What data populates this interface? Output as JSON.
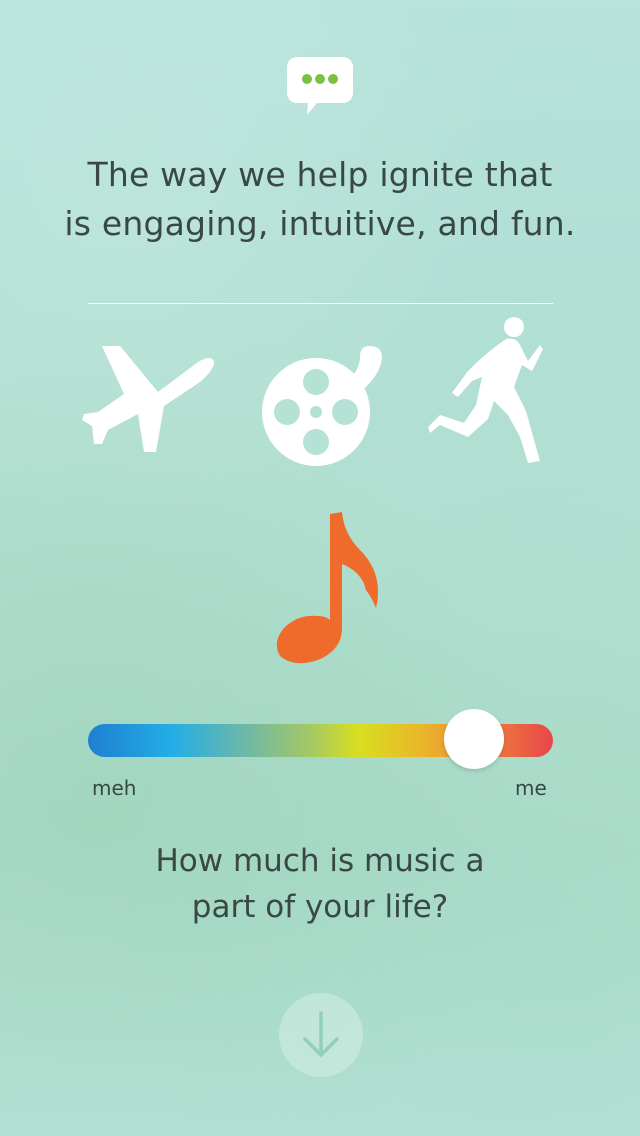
{
  "header": {
    "icon": "chat-bubble-icon",
    "headline_line1": "The way we help ignite that",
    "headline_line2": "is engaging, intuitive, and fun."
  },
  "categories": [
    {
      "icon": "airplane-icon"
    },
    {
      "icon": "film-reel-icon"
    },
    {
      "icon": "runner-icon"
    }
  ],
  "selected_category": {
    "icon": "music-note-icon",
    "color": "#ef6b2c"
  },
  "slider": {
    "value_fraction": 0.83,
    "min_label": "meh",
    "max_label": "me"
  },
  "question": {
    "line1": "How much is music a",
    "line2": "part of your life?"
  },
  "next_button": {
    "icon": "arrow-down-icon"
  },
  "colors": {
    "accent_green": "#7bc142",
    "note_orange": "#ef6b2c",
    "slider_start": "#1f7fd0",
    "slider_end": "#e8464b"
  }
}
